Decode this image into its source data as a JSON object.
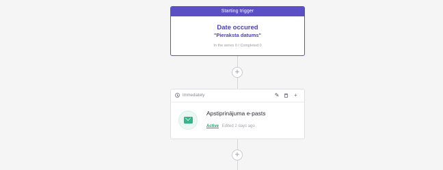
{
  "trigger": {
    "header": "Starting trigger",
    "title": "Date occured",
    "subtitle": "\"Pieraksta datums\"",
    "stats": "In the series 0 / Completed 0"
  },
  "step": {
    "timing": "Immediately",
    "title": "Apstiprinājuma e-pasts",
    "status": "Active",
    "edited": "Edited 2 days ago"
  },
  "add_glyph": "+",
  "colors": {
    "accent": "#5a4fc4",
    "success": "#23a06f"
  },
  "icons": [
    "clock-icon",
    "pencil-icon",
    "trash-icon",
    "plus-icon",
    "mail-icon"
  ]
}
